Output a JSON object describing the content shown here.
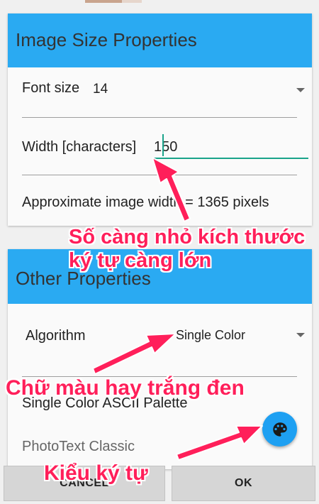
{
  "image_size": {
    "header": "Image Size Properties",
    "font_size_label": "Font size",
    "font_size_value": "14",
    "width_label": "Width [characters]",
    "width_value": "150",
    "approx_text": "Approximate image width = 1365 pixels"
  },
  "other": {
    "header": "Other Properties",
    "algorithm_label": "Algorithm",
    "algorithm_value": "Single Color",
    "palette_label": "Single Color ASCII Palette",
    "style_label": "PhotoText Classic"
  },
  "buttons": {
    "cancel": "CANCEL",
    "ok": "OK"
  },
  "annotations": {
    "note1_line1": "Số càng nhỏ kích thước",
    "note1_line2": "ký tự càng lớn",
    "note2": "Chữ màu hay trắng đen",
    "note3": "Kiểu ký tự"
  },
  "colors": {
    "accent": "#2aaaf2",
    "annotation": "#ff1f5a",
    "input_underline": "#1aa38a"
  },
  "icons": {
    "fab": "palette-icon",
    "dropdown": "caret-down-icon"
  }
}
